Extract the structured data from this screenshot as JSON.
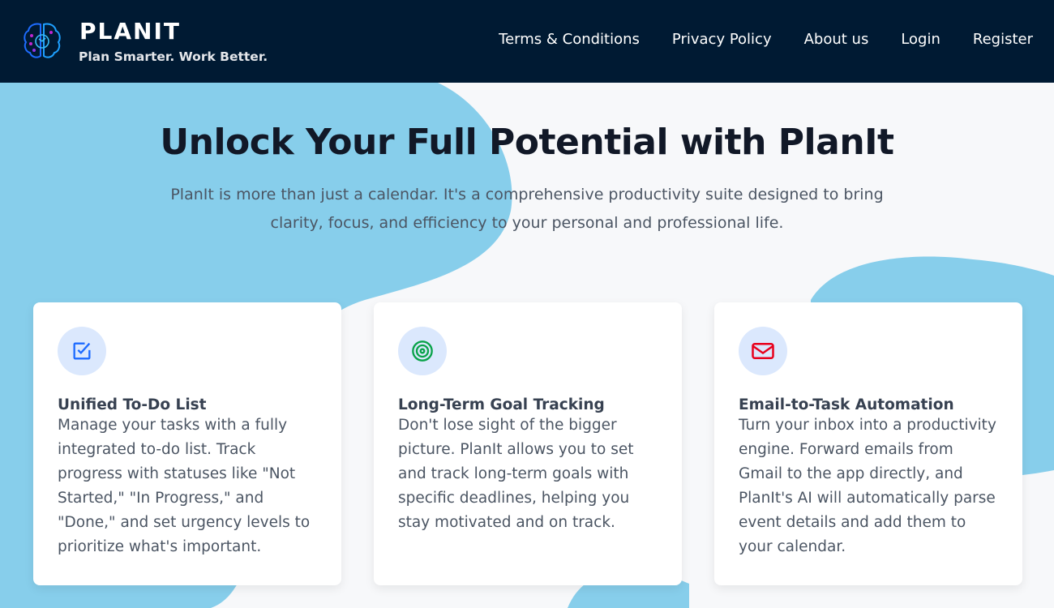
{
  "header": {
    "brand": "PLANIT",
    "tagline": "Plan Smarter. Work Better.",
    "nav": [
      "Terms & Conditions",
      "Privacy Policy",
      "About us",
      "Login",
      "Register"
    ]
  },
  "hero": {
    "title": "Unlock Your Full Potential with PlanIt",
    "subtitle": "PlanIt is more than just a calendar. It's a comprehensive productivity suite designed to bring clarity, focus, and efficiency to your personal and professional life."
  },
  "features": [
    {
      "icon": "checkbox-icon",
      "color": "#1d6bff",
      "title": "Unified To-Do List",
      "text": "Manage your tasks with a fully integrated to-do list. Track progress with statuses like \"Not Started,\" \"In Progress,\" and \"Done,\" and set urgency levels to prioritize what's important."
    },
    {
      "icon": "target-icon",
      "color": "#0aa34a",
      "title": "Long-Term Goal Tracking",
      "text": "Don't lose sight of the bigger picture. PlanIt allows you to set and track long-term goals with specific deadlines, helping you stay motivated and on track."
    },
    {
      "icon": "envelope-icon",
      "color": "#e8001c",
      "title": "Email-to-Task Automation",
      "text": "Turn your inbox into a productivity engine. Forward emails from Gmail to the app directly, and PlanIt's AI will automatically parse event details and add them to your calendar."
    }
  ]
}
